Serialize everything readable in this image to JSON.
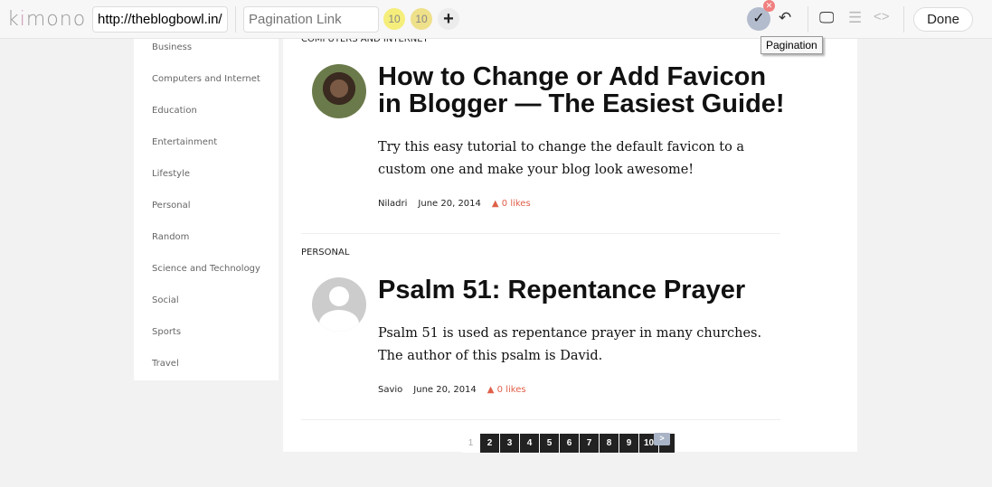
{
  "toolbar": {
    "logo": "kimono",
    "url_value": "http://theblogbowl.in/fe",
    "pagination_placeholder": "Pagination Link",
    "count1": "10",
    "count2": "10",
    "done_label": "Done",
    "tooltip": "Pagination",
    "colors": {
      "count1": "#f5ee7a",
      "count2": "#efe08a",
      "check": "#b3bccd",
      "close": "#f08080"
    }
  },
  "sidebar": {
    "items": [
      "Business",
      "Computers and Internet",
      "Education",
      "Entertainment",
      "Lifestyle",
      "Personal",
      "Random",
      "Science and Technology",
      "Social",
      "Sports",
      "Travel"
    ]
  },
  "posts": [
    {
      "category": "COMPUTERS AND INTERNET",
      "title_line1": "How to Change or Add Favicon",
      "title_line2": "in Blogger — The Easiest Guide!",
      "excerpt": "Try this easy tutorial to change the default favicon to a custom one and make your blog look awesome!",
      "author": "Niladri",
      "date": "June 20, 2014",
      "likes": "▲ 0 likes"
    },
    {
      "category": "PERSONAL",
      "title_line1": "Psalm 51: Repentance Prayer",
      "title_line2": "",
      "excerpt": "Psalm 51 is used as repentance prayer in many churches. The author of this psalm is David.",
      "author": "Savio",
      "date": "June 20, 2014",
      "likes": "▲ 0 likes"
    }
  ],
  "pagination": {
    "current": "1",
    "pages": [
      "2",
      "3",
      "4",
      "5",
      "6",
      "7",
      "8",
      "9",
      "10"
    ],
    "next": ">"
  }
}
